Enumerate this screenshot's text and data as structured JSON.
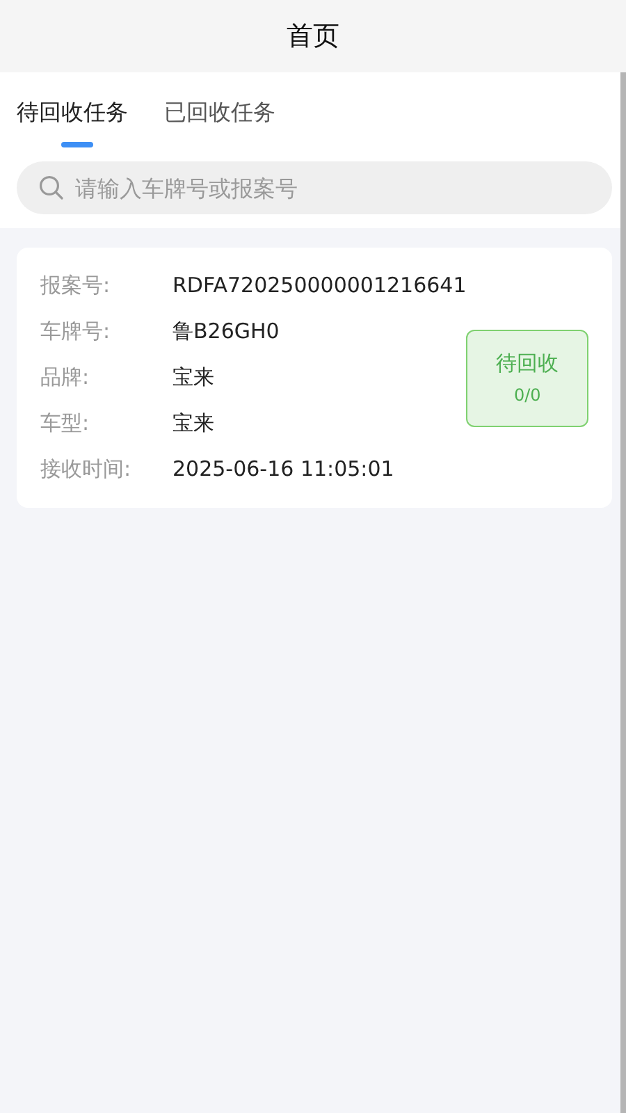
{
  "header": {
    "title": "首页"
  },
  "tabs": [
    {
      "label": "待回收任务",
      "selected": true
    },
    {
      "label": "已回收任务",
      "selected": false
    }
  ],
  "search": {
    "placeholder": "请输入车牌号或报案号"
  },
  "tasks": [
    {
      "fields": [
        {
          "label": "报案号:",
          "value": "RDFA720250000001216641"
        },
        {
          "label": "车牌号:",
          "value": "鲁B26GH0"
        },
        {
          "label": "品牌:",
          "value": "宝来"
        },
        {
          "label": "车型:",
          "value": "宝来"
        },
        {
          "label": "接收时间:",
          "value": "2025-06-16 11:05:01"
        }
      ],
      "status": {
        "kind": "pending",
        "label": "待回收",
        "count": "0/0"
      }
    }
  ]
}
